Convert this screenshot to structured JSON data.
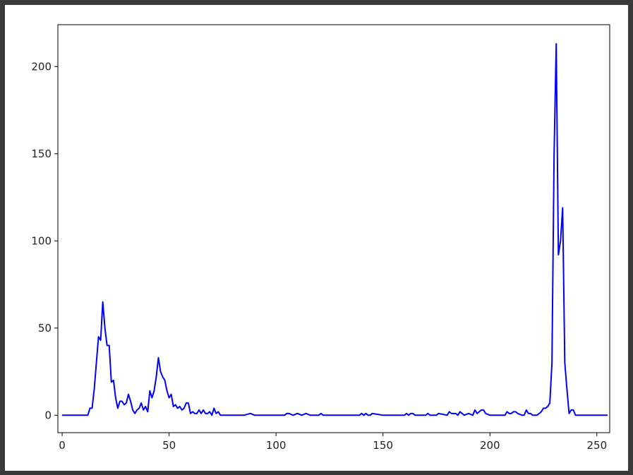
{
  "chart_data": {
    "type": "line",
    "title": "",
    "xlabel": "",
    "ylabel": "",
    "xlim": [
      -2,
      256
    ],
    "ylim": [
      -10,
      224
    ],
    "x_ticks": [
      0,
      50,
      100,
      150,
      200,
      250
    ],
    "y_ticks": [
      0,
      50,
      100,
      150,
      200
    ],
    "grid": false,
    "line_color": "#0000ff",
    "series": [
      {
        "x": [
          0,
          5,
          10,
          12,
          13,
          14,
          15,
          16,
          17,
          18,
          19,
          20,
          21,
          22,
          23,
          24,
          25,
          26,
          27,
          28,
          29,
          30,
          31,
          32,
          33,
          34,
          35,
          36,
          37,
          38,
          39,
          40,
          41,
          42,
          43,
          44,
          45,
          46,
          47,
          48,
          49,
          50,
          51,
          52,
          53,
          54,
          55,
          56,
          57,
          58,
          59,
          60,
          61,
          62,
          63,
          64,
          65,
          66,
          67,
          68,
          69,
          70,
          71,
          72,
          73,
          74,
          75,
          80,
          85,
          88,
          90,
          100,
          104,
          105,
          106,
          108,
          110,
          112,
          114,
          116,
          120,
          121,
          122,
          130,
          139,
          140,
          141,
          142,
          143,
          144,
          145,
          150,
          160,
          161,
          162,
          163,
          164,
          165,
          170,
          171,
          172,
          175,
          176,
          180,
          181,
          182,
          184,
          185,
          186,
          188,
          190,
          192,
          193,
          194,
          195,
          196,
          197,
          198,
          200,
          205,
          207,
          208,
          209,
          210,
          211,
          212,
          213,
          215,
          216,
          217,
          218,
          219,
          220,
          222,
          224,
          225,
          226,
          227,
          228,
          229,
          230,
          231,
          232,
          233,
          234,
          235,
          236,
          237,
          238,
          239,
          240,
          245,
          250,
          255
        ],
        "y": [
          0,
          0,
          0,
          0,
          4,
          4,
          15,
          30,
          45,
          43,
          65,
          50,
          40,
          40,
          19,
          20,
          10,
          4,
          8,
          8,
          6,
          7,
          12,
          8,
          3,
          1,
          3,
          4,
          7,
          3,
          5,
          2,
          14,
          10,
          14,
          22,
          33,
          25,
          22,
          20,
          14,
          10,
          12,
          5,
          6,
          4,
          5,
          3,
          4,
          7,
          7,
          1,
          2,
          1,
          1,
          3,
          1,
          3,
          1,
          1,
          2,
          0,
          4,
          1,
          2,
          0,
          0,
          0,
          0,
          1,
          0,
          0,
          0,
          1,
          1,
          0,
          1,
          0,
          1,
          0,
          0,
          1,
          0,
          0,
          0,
          1,
          0,
          1,
          0,
          0,
          1,
          0,
          0,
          1,
          0,
          1,
          1,
          0,
          0,
          1,
          0,
          0,
          1,
          0,
          2,
          1,
          1,
          0,
          2,
          0,
          1,
          0,
          3,
          1,
          2,
          3,
          3,
          1,
          0,
          0,
          0,
          2,
          1,
          1,
          2,
          2,
          1,
          0,
          0,
          3,
          1,
          1,
          0,
          0,
          2,
          4,
          4,
          5,
          7,
          30,
          150,
          213,
          92,
          100,
          119,
          30,
          15,
          1,
          3,
          3,
          0,
          0,
          0,
          0
        ]
      }
    ]
  }
}
